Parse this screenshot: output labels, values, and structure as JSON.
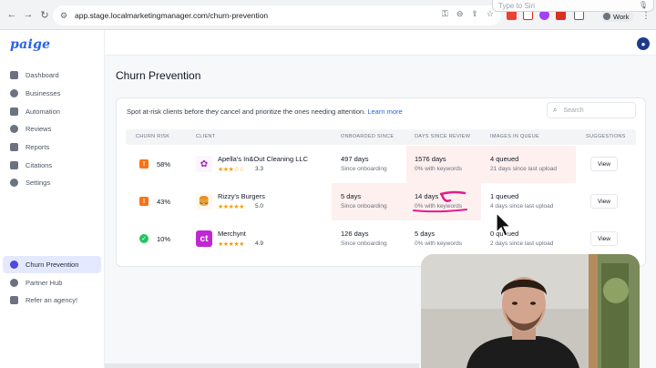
{
  "browser": {
    "url": "app.stage.localmarketingmanager.com/churn-prevention",
    "siri_placeholder": "Type to Siri",
    "profile": "Work",
    "extension_colors": [
      "#ea4335",
      "#d93025",
      "#a142f4",
      "#d93025",
      "#5f6368"
    ]
  },
  "sidebar": {
    "logo": "paige",
    "items": [
      {
        "label": "Dashboard",
        "icon": "grid-icon"
      },
      {
        "label": "Businesses",
        "icon": "shield-icon"
      },
      {
        "label": "Automation",
        "icon": "bolt-icon"
      },
      {
        "label": "Reviews",
        "icon": "chat-icon"
      },
      {
        "label": "Reports",
        "icon": "chart-icon"
      },
      {
        "label": "Citations",
        "icon": "map-pin-icon"
      },
      {
        "label": "Settings",
        "icon": "gear-icon"
      }
    ],
    "bottom": [
      {
        "label": "Churn Prevention",
        "icon": "x-circle-icon",
        "active": true
      },
      {
        "label": "Partner Hub",
        "icon": "shield-icon"
      },
      {
        "label": "Refer an agency!",
        "icon": "megaphone-icon"
      }
    ]
  },
  "main": {
    "title": "Churn Prevention",
    "intro": "Spot at-risk clients before they cancel and prioritize the ones needing attention.",
    "learn_more": "Learn more",
    "search_placeholder": "Search",
    "columns": [
      "CHURN RISK",
      "CLIENT",
      "ONBOARDED SINCE",
      "DAYS SINCE REVIEW",
      "IMAGES IN QUEUE",
      "SUGGESTIONS"
    ],
    "rows": [
      {
        "risk_level": "high",
        "risk": "58%",
        "client": "Apella's In&Out Cleaning LLC",
        "stars": "★★★☆☆",
        "rating": "3.3",
        "logo_text": "✿",
        "logo_color": "#a21caf",
        "logo_bg": "#fdf4ff",
        "onboarded": "497 days",
        "onboarded_sub": "Since onboarding",
        "review": "1576 days",
        "review_sub": "0% with keywords",
        "images": "4 queued",
        "images_sub": "21 days since last upload",
        "action": "View",
        "highlight": [
          "review",
          "images"
        ]
      },
      {
        "risk_level": "high",
        "risk": "43%",
        "client": "Rizzy's Burgers",
        "stars": "★★★★★",
        "rating": "5.0",
        "logo_text": "🍔",
        "logo_color": "#b45309",
        "logo_bg": "#fff7ed",
        "onboarded": "5 days",
        "onboarded_sub": "Since onboarding",
        "review": "14 days",
        "review_sub": "0% with keywords",
        "images": "1 queued",
        "images_sub": "4 days since last upload",
        "action": "View",
        "highlight": [
          "onboarded",
          "review"
        ]
      },
      {
        "risk_level": "low",
        "risk": "10%",
        "client": "Merchynt",
        "stars": "★★★★★",
        "rating": "4.9",
        "logo_text": "ct",
        "logo_color": "#ffffff",
        "logo_bg": "#c026d3",
        "onboarded": "126 days",
        "onboarded_sub": "Since onboarding",
        "review": "5 days",
        "review_sub": "0% with keywords",
        "images": "0 queued",
        "images_sub": "2 days since last upload",
        "action": "View",
        "highlight": []
      }
    ]
  }
}
